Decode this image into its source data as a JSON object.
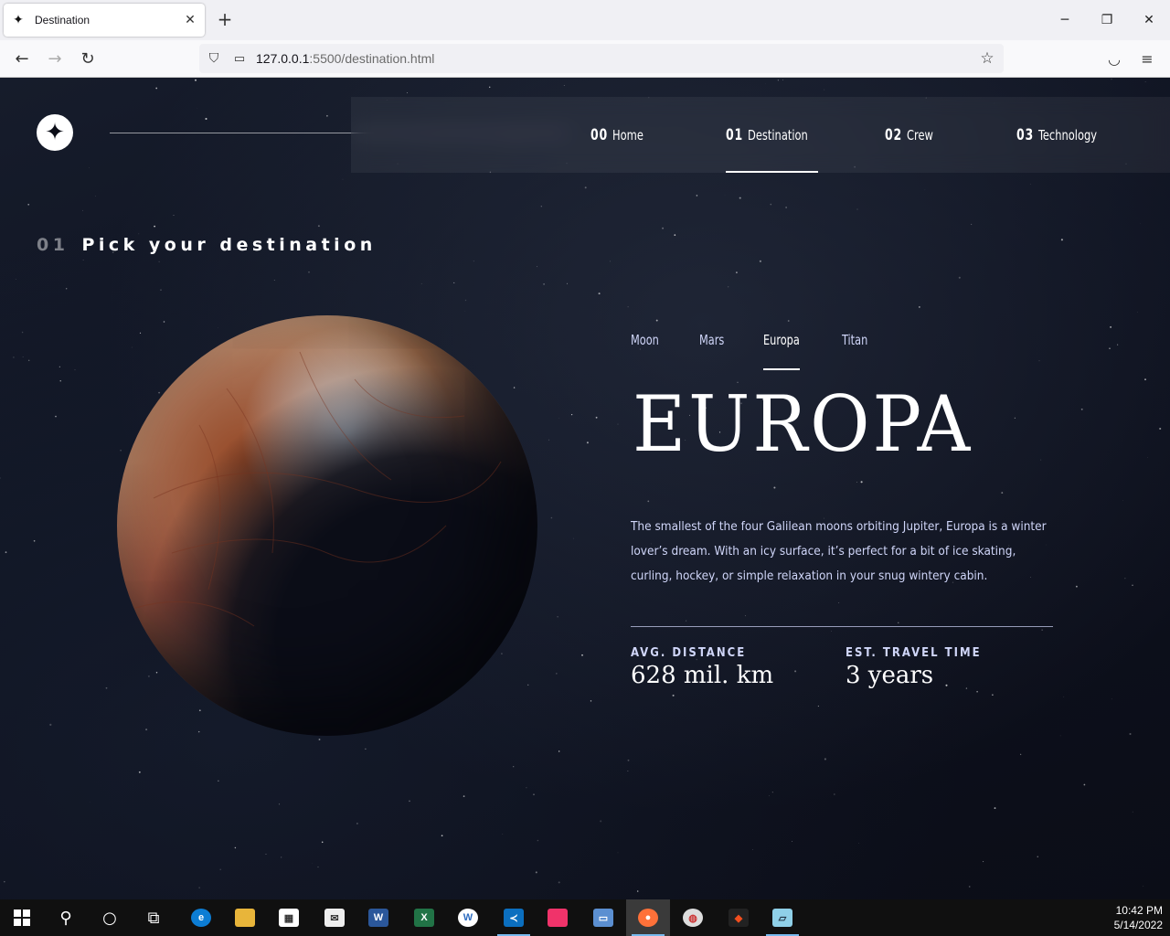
{
  "browser": {
    "tab_title": "Destination",
    "url_host": "127.0.0.1",
    "url_rest": ":5500/destination.html"
  },
  "site": {
    "nav": [
      {
        "num": "00",
        "label": "Home"
      },
      {
        "num": "01",
        "label": "Destination"
      },
      {
        "num": "02",
        "label": "Crew"
      },
      {
        "num": "03",
        "label": "Technology"
      }
    ],
    "heading_num": "01",
    "heading_text": "Pick your destination",
    "destination_tabs": [
      "Moon",
      "Mars",
      "Europa",
      "Titan"
    ],
    "active_tab": "Europa",
    "destination_name": "EUROPA",
    "description": "The smallest of the four Galilean moons orbiting Jupiter, Europa is a winter lover’s dream. With an icy surface, it’s perfect for a bit of ice skating, curling, hockey, or simple relaxation in your snug wintery cabin.",
    "distance_label": "AVG. DISTANCE",
    "distance_value": "628 mil. km",
    "travel_label": "EST. TRAVEL TIME",
    "travel_value": "3 years"
  },
  "taskbar": {
    "time": "10:42 PM",
    "date": "5/14/2022"
  }
}
